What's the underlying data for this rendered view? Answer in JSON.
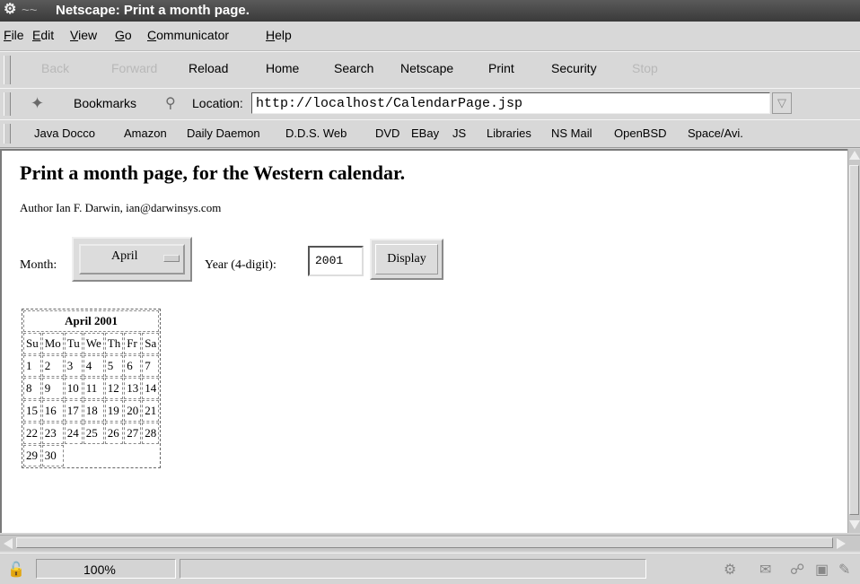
{
  "window": {
    "title": "Netscape: Print a month page.",
    "title_prefix": "~~"
  },
  "menu": [
    {
      "label": "File",
      "u": "F",
      "rest": "ile"
    },
    {
      "label": "Edit",
      "u": "E",
      "rest": "dit"
    },
    {
      "label": "View",
      "u": "V",
      "rest": "iew"
    },
    {
      "label": "Go",
      "u": "G",
      "rest": "o"
    },
    {
      "label": "Communicator",
      "u": "C",
      "rest": "ommunicator"
    },
    {
      "label": "Help",
      "u": "H",
      "rest": "elp"
    }
  ],
  "nav": {
    "back": "Back",
    "forward": "Forward",
    "reload": "Reload",
    "home": "Home",
    "search": "Search",
    "netscape": "Netscape",
    "print": "Print",
    "security": "Security",
    "stop": "Stop"
  },
  "location": {
    "bookmarks_label": "Bookmarks",
    "location_label": "Location:",
    "url": "http://localhost/CalendarPage.jsp"
  },
  "personal_toolbar": [
    "Java Docco",
    "Amazon",
    "Daily Daemon",
    "D.D.S. Web",
    "DVD",
    "EBay",
    "JS",
    "Libraries",
    "NS Mail",
    "OpenBSD",
    "Space/Avi."
  ],
  "page": {
    "heading": "Print a month page, for the Western calendar.",
    "author": "Author Ian F. Darwin, ian@darwinsys.com",
    "month_label": "Month:",
    "month_value": "April",
    "year_label": "Year (4-digit):",
    "year_value": "2001",
    "display_button": "Display"
  },
  "calendar": {
    "caption": "April 2001",
    "weekdays": [
      "Su",
      "Mo",
      "Tu",
      "We",
      "Th",
      "Fr",
      "Sa"
    ],
    "weeks": [
      [
        "1",
        "2",
        "3",
        "4",
        "5",
        "6",
        "7"
      ],
      [
        "8",
        "9",
        "10",
        "11",
        "12",
        "13",
        "14"
      ],
      [
        "15",
        "16",
        "17",
        "18",
        "19",
        "20",
        "21"
      ],
      [
        "22",
        "23",
        "24",
        "25",
        "26",
        "27",
        "28"
      ],
      [
        "29",
        "30",
        "",
        "",
        "",
        "",
        ""
      ]
    ]
  },
  "status": {
    "zoom": "100%",
    "message": ""
  },
  "icons": {
    "system_menu": "netscape-system-menu-icon",
    "bookmarks": "bookmarks-icon",
    "location": "location-icon",
    "security_lock": "lock-icon"
  }
}
